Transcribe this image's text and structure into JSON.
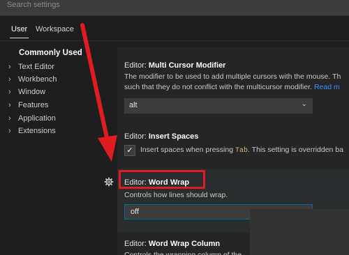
{
  "search": {
    "placeholder": "Search settings"
  },
  "tabs": [
    {
      "label": "User",
      "active": true
    },
    {
      "label": "Workspace",
      "active": false
    }
  ],
  "toc": {
    "heading": "Commonly Used",
    "items": [
      "Text Editor",
      "Workbench",
      "Window",
      "Features",
      "Application",
      "Extensions"
    ]
  },
  "settings": {
    "multi_cursor": {
      "category": "Editor: ",
      "name": "Multi Cursor Modifier",
      "desc_line1": "The modifier to be used to add multiple cursors with the mouse. Th",
      "desc_line2": "such that they do not conflict with the multicursor modifier.",
      "link": "Read m",
      "value": "alt"
    },
    "insert_spaces": {
      "category": "Editor: ",
      "name": "Insert Spaces",
      "desc_pre": "Insert spaces when pressing ",
      "desc_code": "Tab",
      "desc_post": ". This setting is overridden ba",
      "checked": true
    },
    "word_wrap": {
      "category": "Editor: ",
      "name": "Word Wrap",
      "desc": "Controls how lines should wrap.",
      "value": "off"
    },
    "word_wrap_column": {
      "category": "Editor: ",
      "name": "Word Wrap Column",
      "desc": "Controls the wrapping column of the"
    }
  },
  "icons": {
    "checkbox": "✓",
    "chevron_right": "›",
    "chevron_down": "⌄",
    "gear": "gear-icon"
  },
  "colors": {
    "annotation_red": "#e11b22",
    "link": "#3794ff",
    "focus_border": "#0e639c"
  }
}
